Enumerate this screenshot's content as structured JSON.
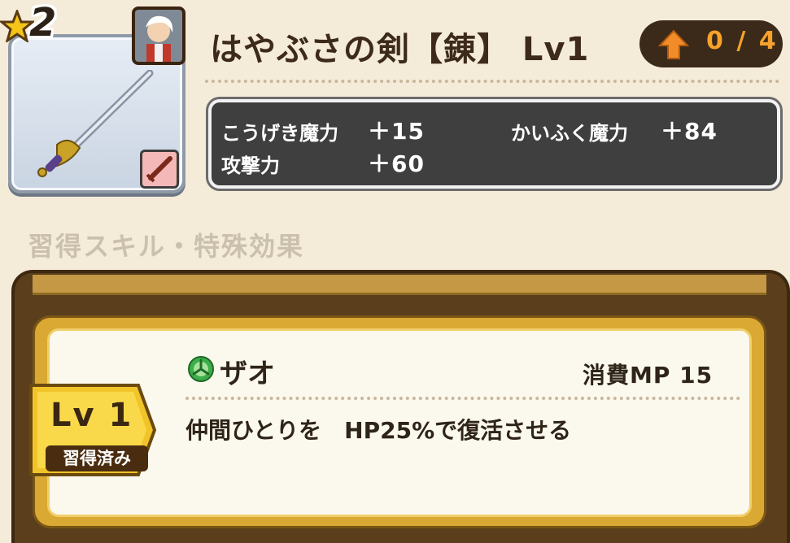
{
  "item": {
    "rarity": "2",
    "name": "はやぶさの剣【錬】 Lv1",
    "upgrade": "0 / 4",
    "icons": [
      "star-icon",
      "sword-icon",
      "character-portrait",
      "sword-type-icon",
      "arrow-up-icon"
    ]
  },
  "stats": {
    "magic_attack_label": "こうげき魔力",
    "magic_attack_value": "＋15",
    "heal_magic_label": "かいふく魔力",
    "heal_magic_value": "＋84",
    "attack_label": "攻撃力",
    "attack_value": "＋60"
  },
  "skills": {
    "section_title": "習得スキル・特殊効果",
    "items": [
      {
        "level": "Lv 1",
        "status": "習得済み",
        "name": "ザオ",
        "cost": "消費MP  15",
        "description": "仲間ひとりを　HP25%で復活させる",
        "icon": "resurrection-icon"
      }
    ]
  },
  "colors": {
    "background": "#f4ebd9",
    "stats_panel": "#3f3f3f",
    "upgrade_text": "#f7a22a",
    "card_gold": "#d9a933"
  }
}
